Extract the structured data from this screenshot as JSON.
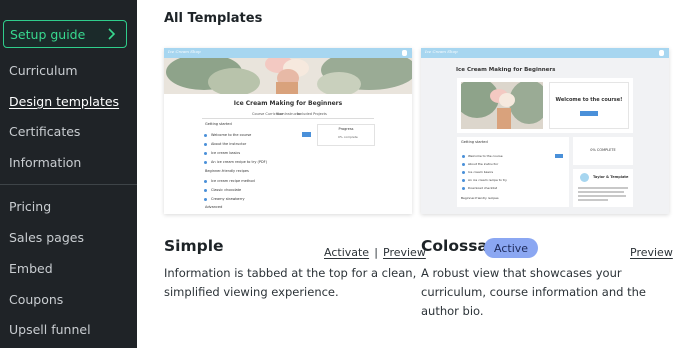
{
  "sidebar": {
    "setup_guide": "Setup guide",
    "items": [
      {
        "label": "Curriculum"
      },
      {
        "label": "Design templates"
      },
      {
        "label": "Certificates"
      },
      {
        "label": "Information"
      },
      {
        "label": "Pricing"
      },
      {
        "label": "Sales pages"
      },
      {
        "label": "Embed"
      },
      {
        "label": "Coupons"
      },
      {
        "label": "Upsell funnel"
      }
    ]
  },
  "main": {
    "title": "All Templates",
    "templates": [
      {
        "name": "Simple",
        "activate_label": "Activate",
        "separator": "|",
        "preview_label": "Preview",
        "description_lines": [
          "Information is tabbed at the top for a clean,",
          "simplified viewing experience."
        ],
        "thumb": {
          "course_title": "Ice Cream Making for Beginners",
          "tabs": [
            "Course Curriculum",
            "Your Instructor",
            "Included Projects"
          ],
          "section1": "Getting started",
          "lessons": [
            "Welcome to the course",
            "About the instructor",
            "Ice cream basics",
            "An ice cream recipe to try (PDF)"
          ],
          "section2": "Beginner-friendly recipes",
          "lessons2": [
            "Ice cream recipe method",
            "Classic chocolate",
            "Creamy strawberry"
          ],
          "section3": "Advanced",
          "progress_label": "Progress",
          "progress_value": "0% complete",
          "start_button": "Start"
        }
      },
      {
        "name": "Colossal",
        "badge": "Active",
        "preview_label": "Preview",
        "description_lines": [
          "A robust view that showcases your",
          "curriculum, course information and the",
          "author bio."
        ],
        "thumb": {
          "course_title": "Ice Cream Making for Beginners",
          "welcome": "Welcome to the course!",
          "section1": "Getting started",
          "lessons": [
            "Welcome to the course",
            "About the instructor",
            "Ice cream basics",
            "An ice cream recipe to try",
            "Download checklist"
          ],
          "section2": "Beginner-friendly recipes",
          "progress_value": "0% COMPLETE",
          "author": "Taylor & Template",
          "start_button": "Start"
        }
      }
    ]
  },
  "colors": {
    "sidebar_bg": "#1f2327",
    "accent_green": "#2fce8c",
    "badge_bg": "#8ba7f2",
    "thumb_header": "#a7d6f0"
  }
}
